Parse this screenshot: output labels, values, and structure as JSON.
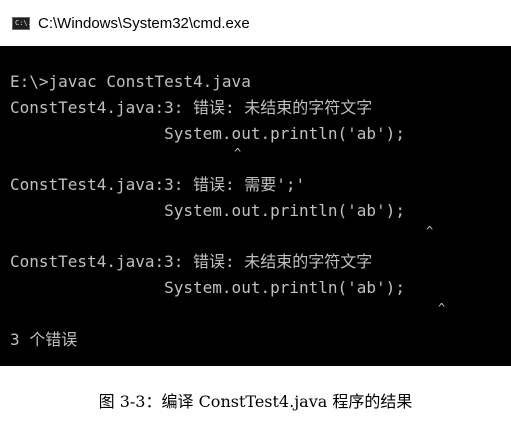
{
  "window": {
    "title": "C:\\Windows\\System32\\cmd.exe",
    "icon": "cmd-console-icon",
    "icon_glyph": "C:\\."
  },
  "console": {
    "text_color": "#c0c0c0",
    "background": "#000000",
    "lines": [
      "E:\\>javac ConstTest4.java",
      "ConstTest4.java:3: 错误: 未结束的字符文字",
      "                System.out.println('ab');",
      "ConstTest4.java:3: 错误: 需要';'",
      "                System.out.println('ab');",
      "ConstTest4.java:3: 错误: 未结束的字符文字",
      "                System.out.println('ab');",
      "3 个错误"
    ],
    "caret": "^"
  },
  "caption": "图 3-3：编译 ConstTest4.java 程序的结果"
}
